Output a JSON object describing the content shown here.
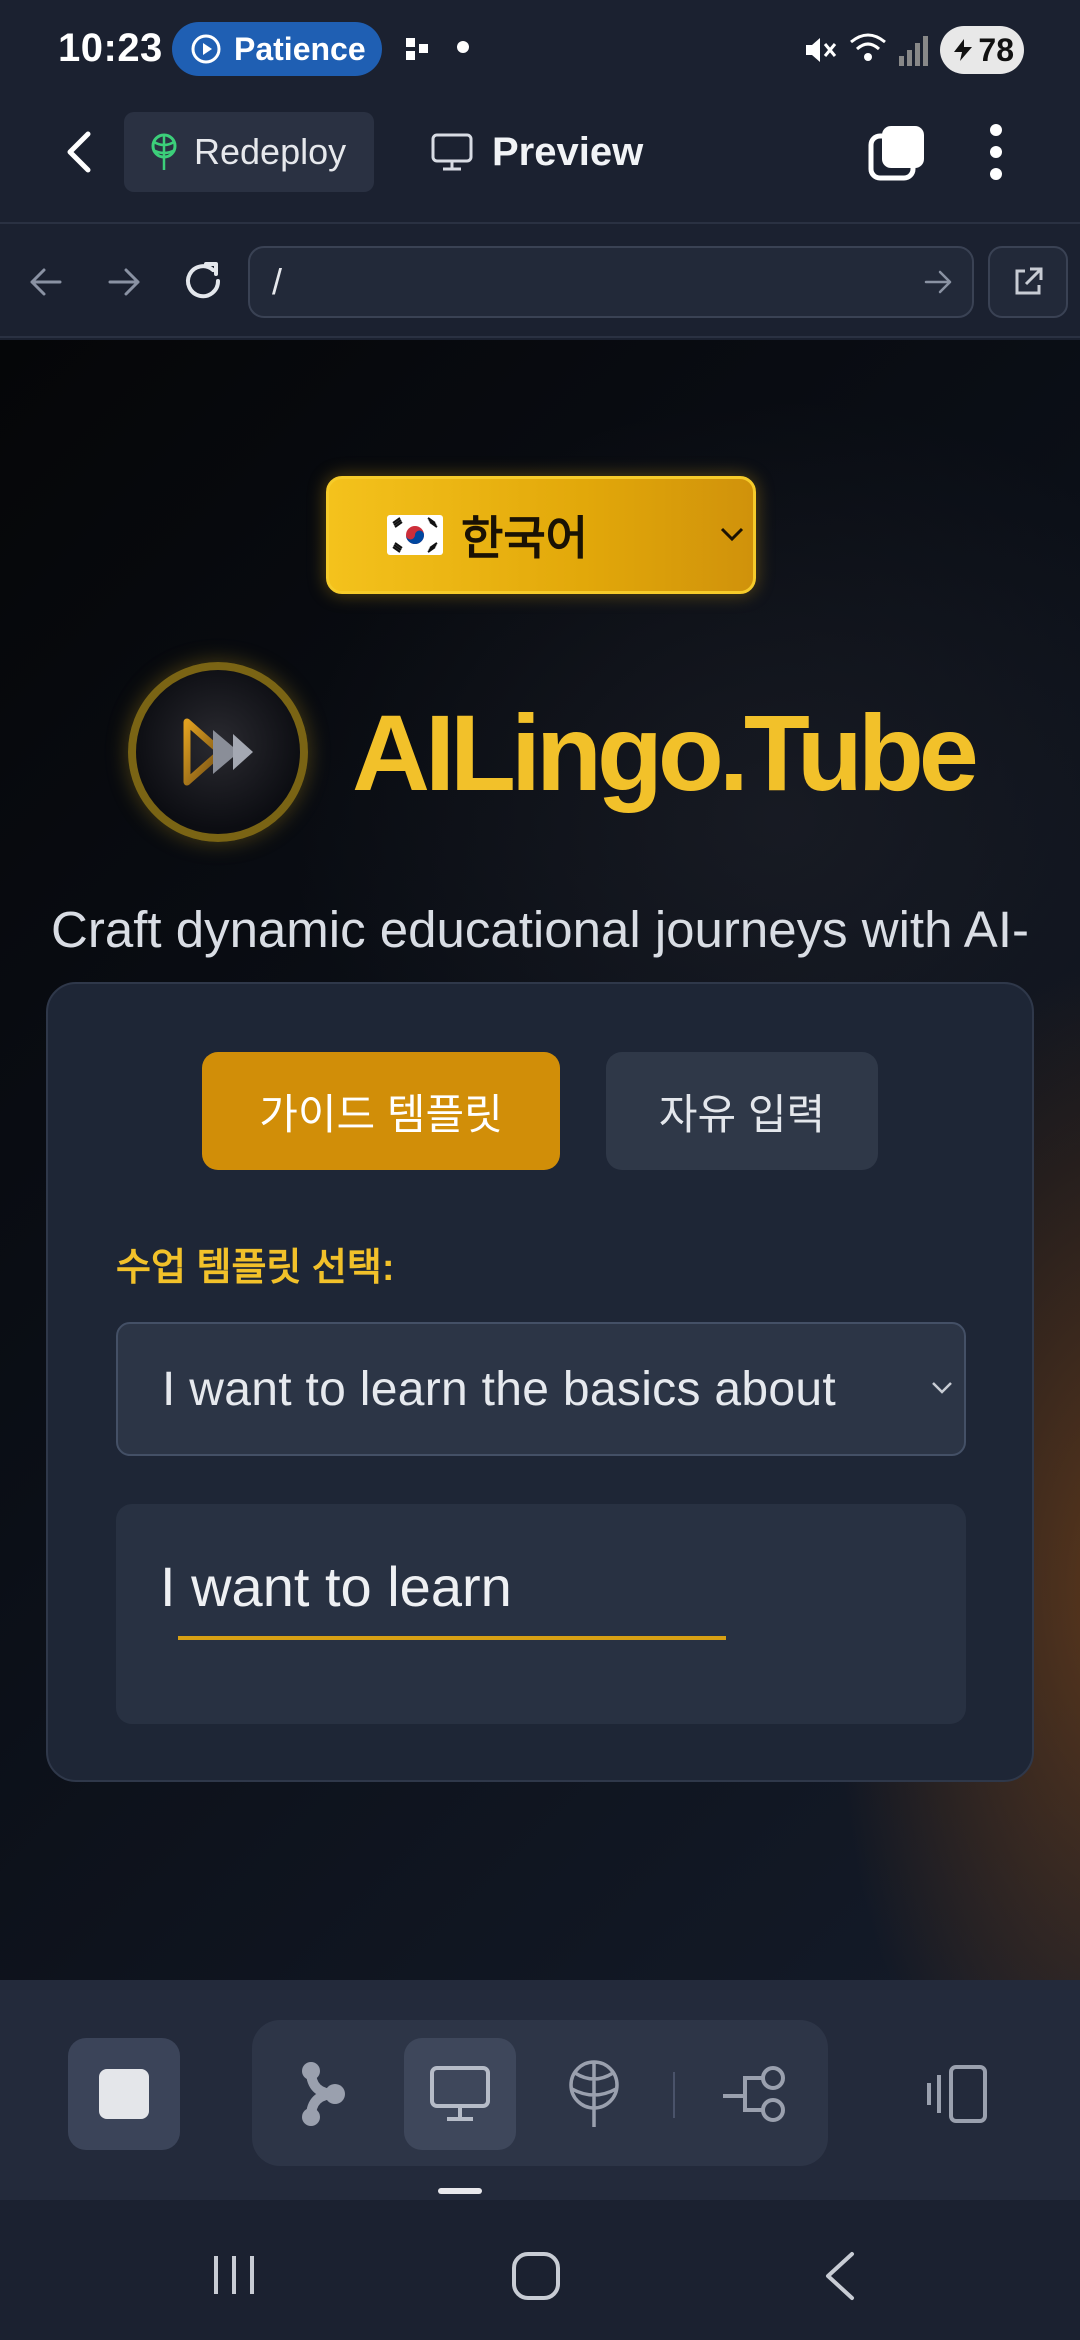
{
  "status_bar": {
    "time": "10:23",
    "app_pill": "Patience",
    "battery": "78"
  },
  "header": {
    "redeploy_label": "Redeploy",
    "preview_label": "Preview"
  },
  "url_bar": {
    "value": "/"
  },
  "web": {
    "language_button": "🇰🇷 한국어",
    "language_label": "한국어",
    "brand": "AILingo.Tube",
    "tagline": "Craft dynamic educational journeys with AI-powered narration, illustrations, and curated video segments.",
    "tabs": [
      {
        "label": "가이드 템플릿",
        "active": true
      },
      {
        "label": "자유 입력",
        "active": false
      }
    ],
    "template_label": "수업 템플릿 선택:",
    "template_select_value": "I want to learn the basics about",
    "input_text": "I want to learn"
  },
  "colors": {
    "accent_gold": "#f2c12a",
    "tab_active": "#d18e08",
    "page_bg": "#1b2130"
  },
  "icons": {
    "status": [
      "play-circle-icon",
      "apps-icon",
      "dot-icon",
      "mute-icon",
      "wifi-icon",
      "signal-icon",
      "battery-icon"
    ],
    "header": [
      "back-arrow-icon",
      "rocket-icon",
      "monitor-icon",
      "tabs-icon",
      "more-vertical-icon"
    ],
    "url": [
      "nav-back-icon",
      "nav-forward-icon",
      "reload-icon",
      "go-arrow-icon",
      "open-external-icon"
    ],
    "toolbar": [
      "stop-icon",
      "agent-icon",
      "monitor-icon",
      "deploy-icon",
      "workflow-icon",
      "device-frame-icon"
    ],
    "system": [
      "recents-icon",
      "home-icon",
      "back-icon"
    ]
  }
}
